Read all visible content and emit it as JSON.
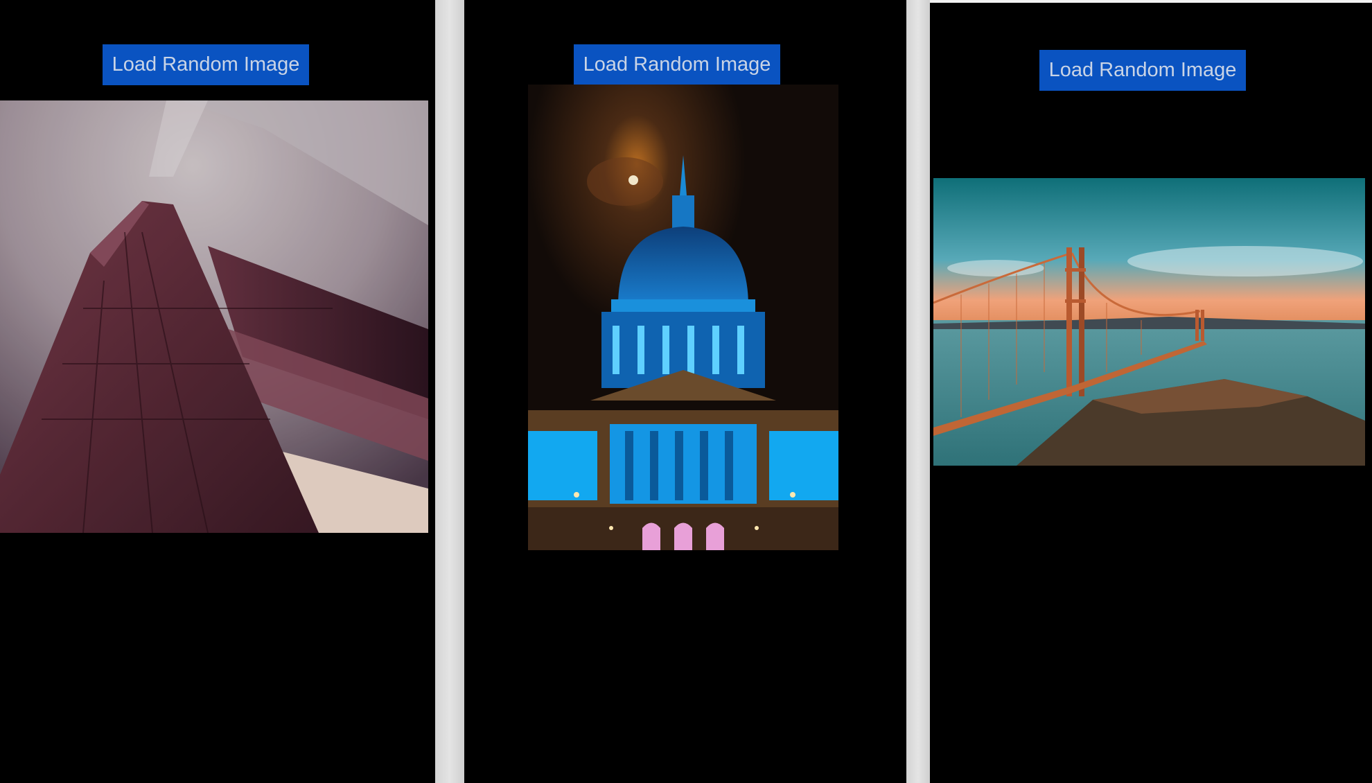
{
  "panels": [
    {
      "button_label": "Load Random Image",
      "image_subject": "golden-gate-tower-closeup"
    },
    {
      "button_label": "Load Random Image",
      "image_subject": "city-hall-dome-night"
    },
    {
      "button_label": "Load Random Image",
      "image_subject": "golden-gate-bridge-sunset"
    }
  ],
  "colors": {
    "background": "#000000",
    "button_bg": "#0a53c1",
    "button_text": "#c9d4e6",
    "divider": "#d6d6d6"
  }
}
